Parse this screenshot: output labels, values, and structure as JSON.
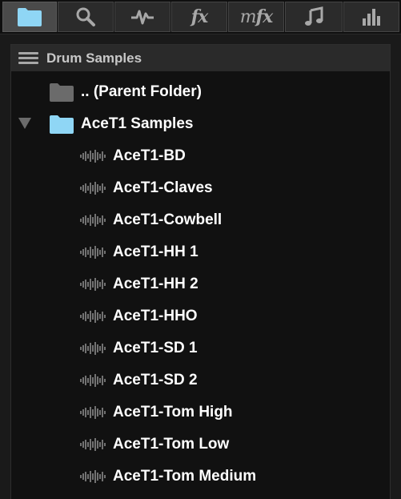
{
  "tabs": [
    {
      "name": "folder",
      "icon": "folder-icon",
      "active": true
    },
    {
      "name": "search",
      "icon": "search-icon",
      "active": false
    },
    {
      "name": "waveform",
      "icon": "waveform-icon",
      "active": false
    },
    {
      "name": "fx",
      "label": "fx",
      "active": false
    },
    {
      "name": "mfx",
      "label_m": "m",
      "label_fx": "fx",
      "active": false
    },
    {
      "name": "music",
      "icon": "music-note-icon",
      "active": false
    },
    {
      "name": "levels",
      "icon": "bar-chart-icon",
      "active": false
    }
  ],
  "panel": {
    "title": "Drum Samples",
    "parent_folder": ".. (Parent Folder)",
    "folder": {
      "label": "AceT1 Samples",
      "expanded": true
    },
    "files": [
      "AceT1-BD",
      "AceT1-Claves",
      "AceT1-Cowbell",
      "AceT1-HH 1",
      "AceT1-HH 2",
      "AceT1-HHO",
      "AceT1-SD 1",
      "AceT1-SD 2",
      "AceT1-Tom High",
      "AceT1-Tom Low",
      "AceT1-Tom Medium"
    ]
  },
  "colors": {
    "active_folder": "#8fd6f5",
    "inactive_folder": "#6b6b6b",
    "icon_gray": "#a8a8a8"
  }
}
